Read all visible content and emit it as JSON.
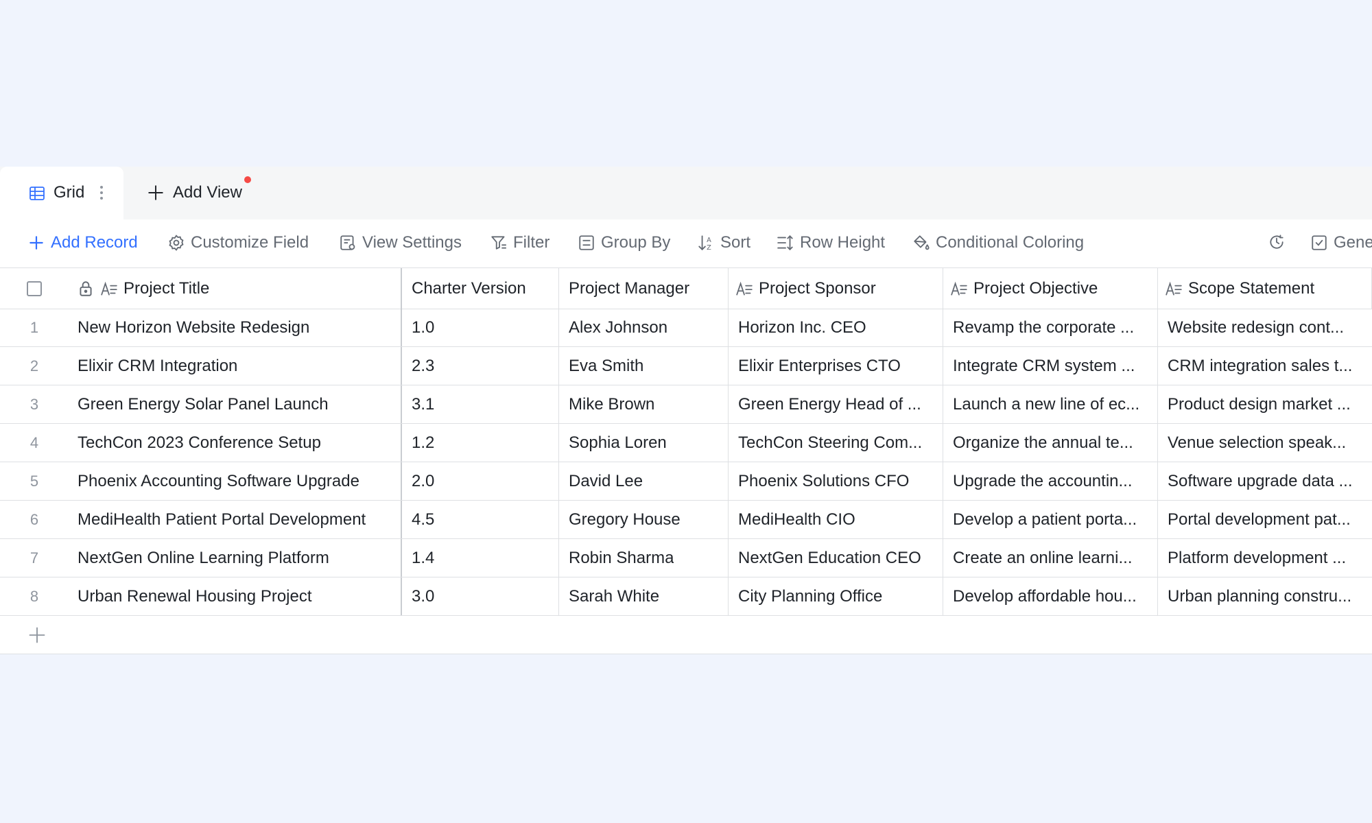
{
  "tabs": {
    "active_label": "Grid",
    "add_view_label": "Add View"
  },
  "toolbar": {
    "add_record": "Add Record",
    "customize_field": "Customize Field",
    "view_settings": "View Settings",
    "filter": "Filter",
    "group_by": "Group By",
    "sort": "Sort",
    "row_height": "Row Height",
    "conditional_coloring": "Conditional Coloring",
    "generate_partial": "Gene"
  },
  "colors": {
    "accent": "#3370ff",
    "notification_dot": "#f54a45",
    "page_background": "#f0f4fd"
  },
  "table": {
    "columns": [
      {
        "label": "Project Title",
        "icon": "text-field-icon",
        "locked": true
      },
      {
        "label": "Charter Version"
      },
      {
        "label": "Project Manager"
      },
      {
        "label": "Project Sponsor",
        "icon": "text-field-icon"
      },
      {
        "label": "Project Objective",
        "icon": "text-field-icon"
      },
      {
        "label": "Scope Statement",
        "icon": "text-field-icon"
      }
    ],
    "rows": [
      {
        "num": "1",
        "title": "New Horizon Website Redesign",
        "version": "1.0",
        "manager": "Alex Johnson",
        "sponsor": "Horizon Inc. CEO",
        "objective": "Revamp the corporate ...",
        "scope": "Website redesign cont..."
      },
      {
        "num": "2",
        "title": "Elixir CRM Integration",
        "version": "2.3",
        "manager": "Eva Smith",
        "sponsor": "Elixir Enterprises CTO",
        "objective": "Integrate CRM system ...",
        "scope": "CRM integration sales t..."
      },
      {
        "num": "3",
        "title": "Green Energy Solar Panel Launch",
        "version": "3.1",
        "manager": "Mike Brown",
        "sponsor": "Green Energy Head of ...",
        "objective": "Launch a new line of ec...",
        "scope": "Product design market ..."
      },
      {
        "num": "4",
        "title": "TechCon 2023 Conference Setup",
        "version": "1.2",
        "manager": "Sophia Loren",
        "sponsor": "TechCon Steering Com...",
        "objective": "Organize the annual te...",
        "scope": "Venue selection speak..."
      },
      {
        "num": "5",
        "title": "Phoenix Accounting Software Upgrade",
        "version": "2.0",
        "manager": "David Lee",
        "sponsor": "Phoenix Solutions CFO",
        "objective": "Upgrade the accountin...",
        "scope": "Software upgrade data ..."
      },
      {
        "num": "6",
        "title": "MediHealth Patient Portal Development",
        "version": "4.5",
        "manager": "Gregory House",
        "sponsor": "MediHealth CIO",
        "objective": "Develop a patient porta...",
        "scope": "Portal development pat..."
      },
      {
        "num": "7",
        "title": "NextGen Online Learning Platform",
        "version": "1.4",
        "manager": "Robin Sharma",
        "sponsor": "NextGen Education CEO",
        "objective": "Create an online learni...",
        "scope": "Platform development ..."
      },
      {
        "num": "8",
        "title": "Urban Renewal Housing Project",
        "version": "3.0",
        "manager": "Sarah White",
        "sponsor": "City Planning Office",
        "objective": "Develop affordable hou...",
        "scope": "Urban planning constru..."
      }
    ]
  }
}
